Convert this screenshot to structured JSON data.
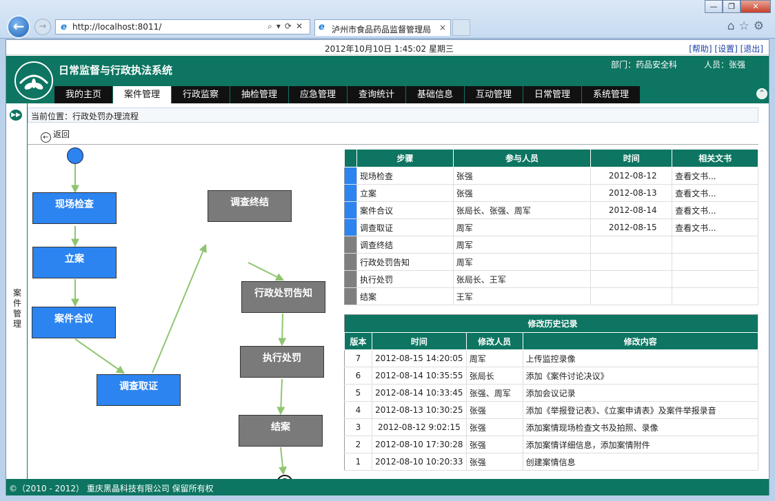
{
  "browser": {
    "url": "http://localhost:8011/",
    "tab_title": "泸州市食品药品监督管理局",
    "tab_close": "×",
    "window_minimize": "—",
    "window_restore": "❐",
    "window_close": "✕"
  },
  "datebar": {
    "datetime": "2012年10月10日 1:45:02 星期三",
    "help": "[帮助]",
    "settings": "[设置]",
    "logout": "[退出]"
  },
  "header": {
    "system_title": "日常监督与行政执法系统",
    "department": "部门：药品安全科",
    "user": "人员：张强"
  },
  "menu": [
    {
      "label": "我的主页",
      "active": false
    },
    {
      "label": "案件管理",
      "active": true
    },
    {
      "label": "行政监察",
      "active": false
    },
    {
      "label": "抽检管理",
      "active": false
    },
    {
      "label": "应急管理",
      "active": false
    },
    {
      "label": "查询统计",
      "active": false
    },
    {
      "label": "基础信息",
      "active": false
    },
    {
      "label": "互动管理",
      "active": false
    },
    {
      "label": "日常管理",
      "active": false
    },
    {
      "label": "系统管理",
      "active": false
    }
  ],
  "sidebar": {
    "label": "案件管理"
  },
  "breadcrumb": "当前位置：行政处罚办理流程",
  "back_label": "返回",
  "flow": {
    "nodes": {
      "xianchang": "现场检查",
      "lian": "立案",
      "huiyi": "案件合议",
      "quzheng": "调查取证",
      "zhongjie": "调查终结",
      "gaozhi": "行政处罚告知",
      "zhixing": "执行处罚",
      "jiean": "结案"
    }
  },
  "steps_table": {
    "headers": [
      "步骤",
      "参与人员",
      "时间",
      "相关文书"
    ],
    "rows": [
      {
        "step": "现场检查",
        "people": "张强",
        "time": "2012-08-12",
        "doc": "查看文书...",
        "status": "done"
      },
      {
        "step": "立案",
        "people": "张强",
        "time": "2012-08-13",
        "doc": "查看文书...",
        "status": "done"
      },
      {
        "step": "案件合议",
        "people": "张局长、张强、周军",
        "time": "2012-08-14",
        "doc": "查看文书...",
        "status": "done"
      },
      {
        "step": "调查取证",
        "people": "周军",
        "time": "2012-08-15",
        "doc": "查看文书...",
        "status": "done"
      },
      {
        "step": "调查终结",
        "people": "周军",
        "time": "",
        "doc": "",
        "status": "todo"
      },
      {
        "step": "行政处罚告知",
        "people": "周军",
        "time": "",
        "doc": "",
        "status": "todo"
      },
      {
        "step": "执行处罚",
        "people": "张局长、王军",
        "time": "",
        "doc": "",
        "status": "todo"
      },
      {
        "step": "结案",
        "people": "王军",
        "time": "",
        "doc": "",
        "status": "todo"
      }
    ]
  },
  "history_table": {
    "caption": "修改历史记录",
    "headers": [
      "版本",
      "时间",
      "修改人员",
      "修改内容"
    ],
    "rows": [
      {
        "version": "7",
        "time": "2012-08-15 14:20:05",
        "user": "周军",
        "content": "上传监控录像"
      },
      {
        "version": "6",
        "time": "2012-08-14 10:35:55",
        "user": "张局长",
        "content": "添加《案件讨论决议》"
      },
      {
        "version": "5",
        "time": "2012-08-14 10:33:45",
        "user": "张强、周军",
        "content": "添加会议记录"
      },
      {
        "version": "4",
        "time": "2012-08-13 10:30:25",
        "user": "张强",
        "content": "添加《举报登记表》、《立案申请表》及案件举报录音"
      },
      {
        "version": "3",
        "time": "2012-08-12 9:02:15",
        "user": "张强",
        "content": "添加案情现场检查文书及拍照、录像"
      },
      {
        "version": "2",
        "time": "2012-08-10 17:30:28",
        "user": "张强",
        "content": "添加案情详细信息，添加案情附件"
      },
      {
        "version": "1",
        "time": "2012-08-10 10:20:33",
        "user": "张强",
        "content": "创建案情信息"
      }
    ]
  },
  "footer": "©（2010 - 2012） 重庆黑晶科技有限公司 保留所有权",
  "colors": {
    "brand_green": "#0d7561",
    "done_blue": "#2c84f0",
    "todo_gray": "#7a7a7a",
    "edge_green": "#8fc470"
  }
}
